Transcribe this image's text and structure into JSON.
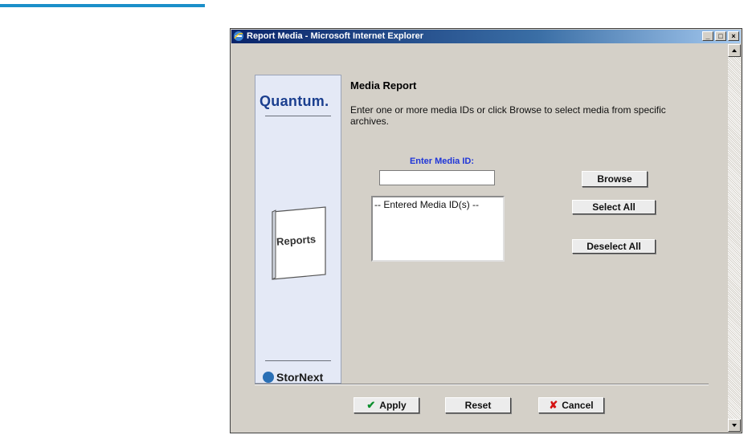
{
  "window": {
    "title": "Report Media - Microsoft Internet Explorer",
    "controls": {
      "minimize": "_",
      "maximize": "□",
      "close": "×"
    }
  },
  "sidebar": {
    "logo": "Quantum.",
    "book_label": "Reports",
    "brand": "StorNext"
  },
  "main": {
    "title": "Media Report",
    "instructions": "Enter one or more media IDs or click Browse to select media from specific archives.",
    "media_id_label": "Enter Media ID:",
    "media_id_value": "",
    "entered_list_header": "-- Entered Media ID(s) --"
  },
  "buttons": {
    "browse": "Browse",
    "select_all": "Select All",
    "deselect_all": "Deselect All",
    "apply": "Apply",
    "reset": "Reset",
    "cancel": "Cancel"
  },
  "icons": {
    "apply": "check-icon",
    "cancel": "x-icon",
    "window": "ie-icon",
    "brand": "stornext-icon"
  },
  "colors": {
    "accent_rule": "#1b8fc9",
    "titlebar": "#0a246a",
    "media_label": "#1f35d8",
    "quantum_logo": "#1b3f8f"
  }
}
